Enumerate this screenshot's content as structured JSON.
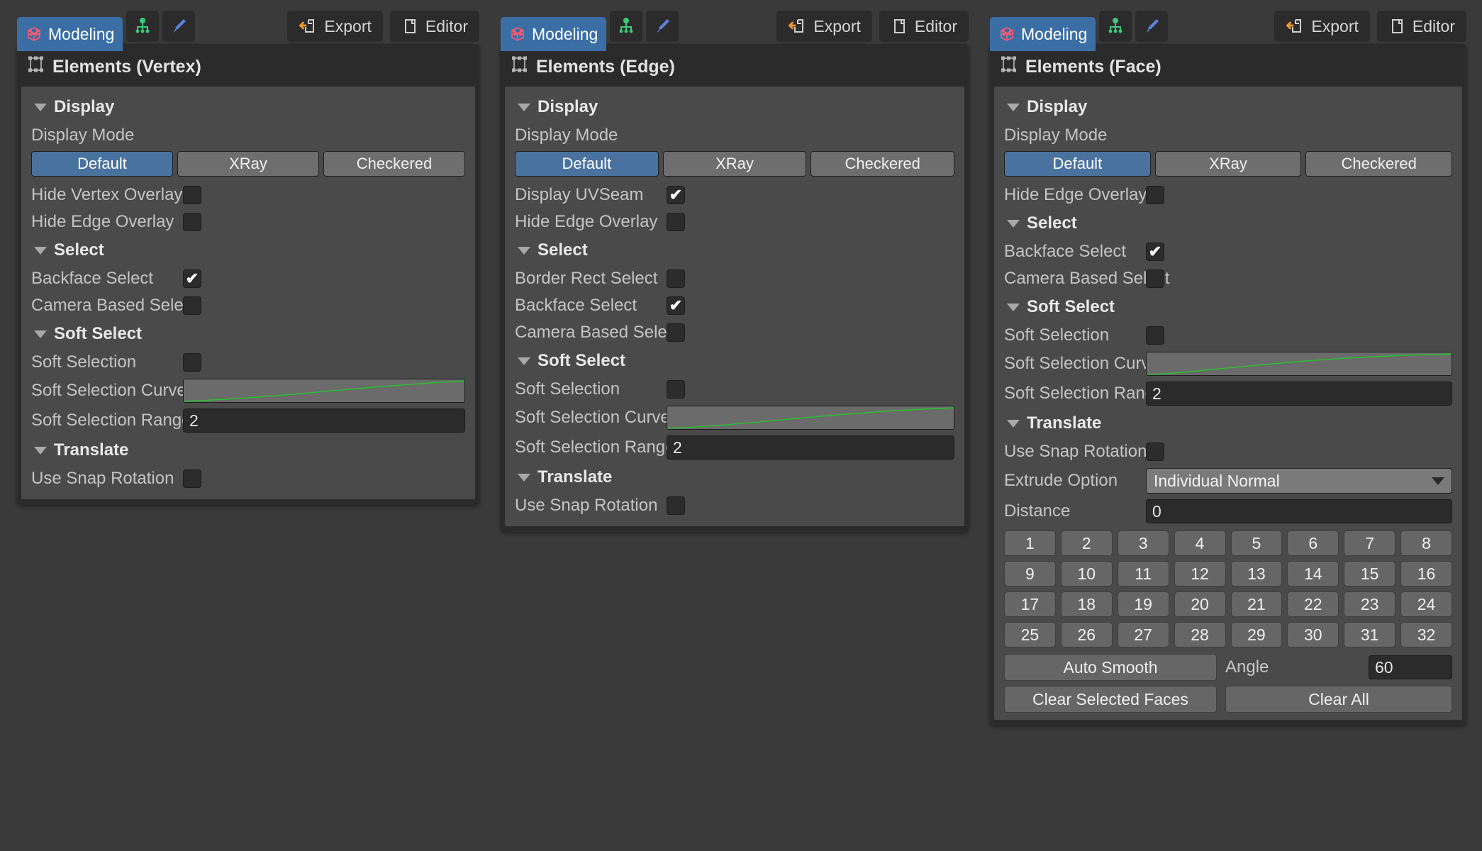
{
  "toolbar": {
    "modeling_tab": "Modeling",
    "modeling_icon": "cube-wireframe-icon",
    "rig_icon": "rig-skeleton-icon",
    "paint_icon": "paint-brush-icon",
    "export_label": "Export",
    "export_icon": "export-arrow-icon",
    "editor_label": "Editor",
    "editor_icon": "editor-page-icon"
  },
  "common": {
    "display_section": "Display",
    "select_section": "Select",
    "soft_select_section": "Soft Select",
    "translate_section": "Translate",
    "display_mode_label": "Display Mode",
    "display_modes": [
      "Default",
      "XRay",
      "Checkered"
    ],
    "display_mode_selected": "Default",
    "hide_vertex_overlay": "Hide Vertex Overlay",
    "hide_edge_overlay": "Hide Edge Overlay",
    "display_uvseam": "Display UVSeam",
    "border_rect_select": "Border Rect Select",
    "backface_select": "Backface Select",
    "camera_based_select": "Camera Based Select",
    "soft_selection": "Soft Selection",
    "soft_selection_curve": "Soft Selection Curve",
    "soft_selection_range": "Soft Selection Range",
    "use_snap_rotation": "Use Snap Rotation",
    "panel_icon": "elements-gizmo-icon",
    "curve_color": "#22c82a"
  },
  "panels": [
    {
      "title": "Elements (Vertex)",
      "display_mode_selected": "Default",
      "rows": [
        {
          "label": "Hide Vertex Overlay",
          "type": "checkbox",
          "checked": false,
          "name": "hide-vertex-overlay"
        },
        {
          "label": "Hide Edge Overlay",
          "type": "checkbox",
          "checked": false,
          "name": "hide-edge-overlay"
        }
      ],
      "select_rows": [
        {
          "label": "Backface Select",
          "type": "checkbox",
          "checked": true,
          "name": "backface-select"
        },
        {
          "label": "Camera Based Select",
          "type": "checkbox",
          "checked": false,
          "name": "camera-based-select"
        }
      ],
      "soft_rows": [
        {
          "label": "Soft Selection",
          "type": "checkbox",
          "checked": false,
          "name": "soft-selection"
        },
        {
          "label": "Soft Selection Curve",
          "type": "curve",
          "curve": "gentle",
          "name": "soft-selection-curve"
        },
        {
          "label": "Soft Selection Range",
          "type": "field",
          "value": "2",
          "name": "soft-selection-range"
        }
      ],
      "translate_rows": [
        {
          "label": "Use Snap Rotation",
          "type": "checkbox",
          "checked": false,
          "name": "use-snap-rotation"
        }
      ]
    },
    {
      "title": "Elements (Edge)",
      "display_mode_selected": "Default",
      "rows": [
        {
          "label": "Display UVSeam",
          "type": "checkbox",
          "checked": true,
          "name": "display-uvseam"
        },
        {
          "label": "Hide Edge Overlay",
          "type": "checkbox",
          "checked": false,
          "name": "hide-edge-overlay"
        }
      ],
      "select_rows": [
        {
          "label": "Border Rect Select",
          "type": "checkbox",
          "checked": false,
          "name": "border-rect-select"
        },
        {
          "label": "Backface Select",
          "type": "checkbox",
          "checked": true,
          "name": "backface-select"
        },
        {
          "label": "Camera Based Select",
          "type": "checkbox",
          "checked": false,
          "name": "camera-based-select"
        }
      ],
      "soft_rows": [
        {
          "label": "Soft Selection",
          "type": "checkbox",
          "checked": false,
          "name": "soft-selection"
        },
        {
          "label": "Soft Selection Curve",
          "type": "curve",
          "curve": "medium",
          "name": "soft-selection-curve"
        },
        {
          "label": "Soft Selection Range",
          "type": "field",
          "value": "2",
          "name": "soft-selection-range"
        }
      ],
      "translate_rows": [
        {
          "label": "Use Snap Rotation",
          "type": "checkbox",
          "checked": false,
          "name": "use-snap-rotation"
        }
      ]
    },
    {
      "title": "Elements (Face)",
      "display_mode_selected": "Default",
      "rows": [
        {
          "label": "Hide Edge Overlay",
          "type": "checkbox",
          "checked": false,
          "name": "hide-edge-overlay"
        }
      ],
      "select_rows": [
        {
          "label": "Backface Select",
          "type": "checkbox",
          "checked": true,
          "name": "backface-select"
        },
        {
          "label": "Camera Based Select",
          "type": "checkbox",
          "checked": false,
          "name": "camera-based-select"
        }
      ],
      "soft_rows": [
        {
          "label": "Soft Selection",
          "type": "checkbox",
          "checked": false,
          "name": "soft-selection"
        },
        {
          "label": "Soft Selection Curve",
          "type": "curve",
          "curve": "strong",
          "name": "soft-selection-curve"
        },
        {
          "label": "Soft Selection Range",
          "type": "field",
          "value": "2",
          "name": "soft-selection-range"
        }
      ],
      "translate_rows": [
        {
          "label": "Use Snap Rotation",
          "type": "checkbox",
          "checked": false,
          "name": "use-snap-rotation"
        },
        {
          "label": "Extrude Option",
          "type": "dropdown",
          "value": "Individual Normal",
          "name": "extrude-option"
        },
        {
          "label": "Distance",
          "type": "field",
          "value": "0",
          "name": "distance"
        }
      ],
      "smoothing_group": {
        "numbers": [
          "1",
          "2",
          "3",
          "4",
          "5",
          "6",
          "7",
          "8",
          "9",
          "10",
          "11",
          "12",
          "13",
          "14",
          "15",
          "16",
          "17",
          "18",
          "19",
          "20",
          "21",
          "22",
          "23",
          "24",
          "25",
          "26",
          "27",
          "28",
          "29",
          "30",
          "31",
          "32"
        ],
        "auto_smooth_label": "Auto Smooth",
        "angle_label": "Angle",
        "angle_value": "60",
        "clear_selected_label": "Clear Selected Faces",
        "clear_all_label": "Clear All"
      }
    }
  ]
}
